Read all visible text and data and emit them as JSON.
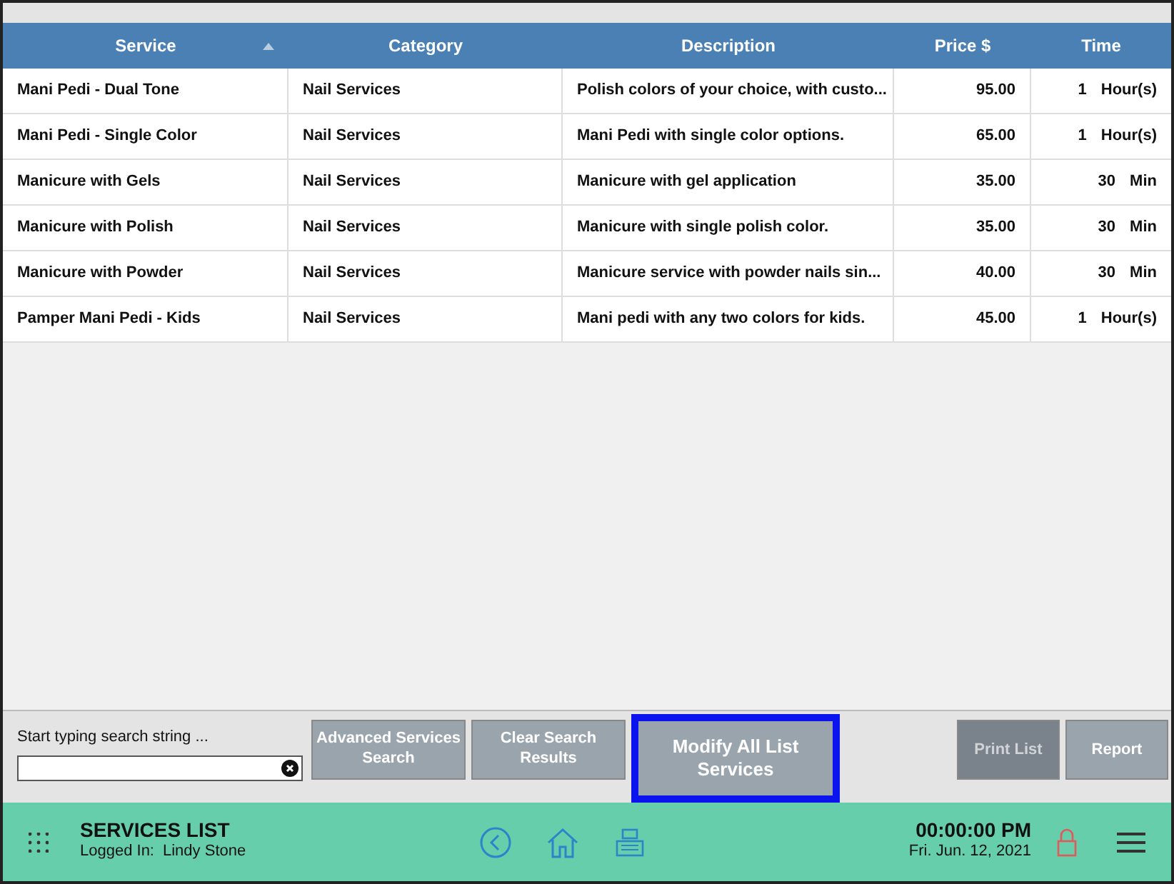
{
  "table": {
    "columns": [
      {
        "label": "Service",
        "sorted": true
      },
      {
        "label": "Category",
        "sorted": false
      },
      {
        "label": "Description",
        "sorted": false
      },
      {
        "label": "Price $",
        "sorted": false
      },
      {
        "label": "Time",
        "sorted": false
      }
    ],
    "rows": [
      {
        "service": "Mani Pedi - Dual Tone",
        "category": "Nail Services",
        "description": "Polish colors of your choice, with custo...",
        "price": "95.00",
        "time": "1",
        "unit": "Hour(s)"
      },
      {
        "service": "Mani Pedi - Single Color",
        "category": "Nail Services",
        "description": "Mani Pedi with single color options.",
        "price": "65.00",
        "time": "1",
        "unit": "Hour(s)"
      },
      {
        "service": "Manicure with Gels",
        "category": "Nail Services",
        "description": "Manicure with gel application",
        "price": "35.00",
        "time": "30",
        "unit": "Min"
      },
      {
        "service": "Manicure with Polish",
        "category": "Nail Services",
        "description": "Manicure with single polish color.",
        "price": "35.00",
        "time": "30",
        "unit": "Min"
      },
      {
        "service": "Manicure with Powder",
        "category": "Nail Services",
        "description": "Manicure service with powder nails sin...",
        "price": "40.00",
        "time": "30",
        "unit": "Min"
      },
      {
        "service": "Pamper Mani Pedi - Kids",
        "category": "Nail Services",
        "description": "Mani pedi with any two colors for kids.",
        "price": "45.00",
        "time": "1",
        "unit": "Hour(s)"
      }
    ]
  },
  "search": {
    "label": "Start typing search string ..."
  },
  "buttons": [
    {
      "label": "Advanced Services Search",
      "highlighted": false,
      "disabled": false
    },
    {
      "label": "Clear Search Results",
      "highlighted": false,
      "disabled": false
    },
    {
      "label": "Modify All List Services",
      "highlighted": true,
      "disabled": false
    }
  ],
  "right_buttons": [
    {
      "label": "Print List",
      "disabled": true
    },
    {
      "label": "Report",
      "disabled": false
    }
  ],
  "footer": {
    "title": "SERVICES LIST",
    "logged_in_label": "Logged In:",
    "user": "Lindy Stone",
    "time": "00:00:00 PM",
    "date": "Fri. Jun. 12, 2021"
  }
}
